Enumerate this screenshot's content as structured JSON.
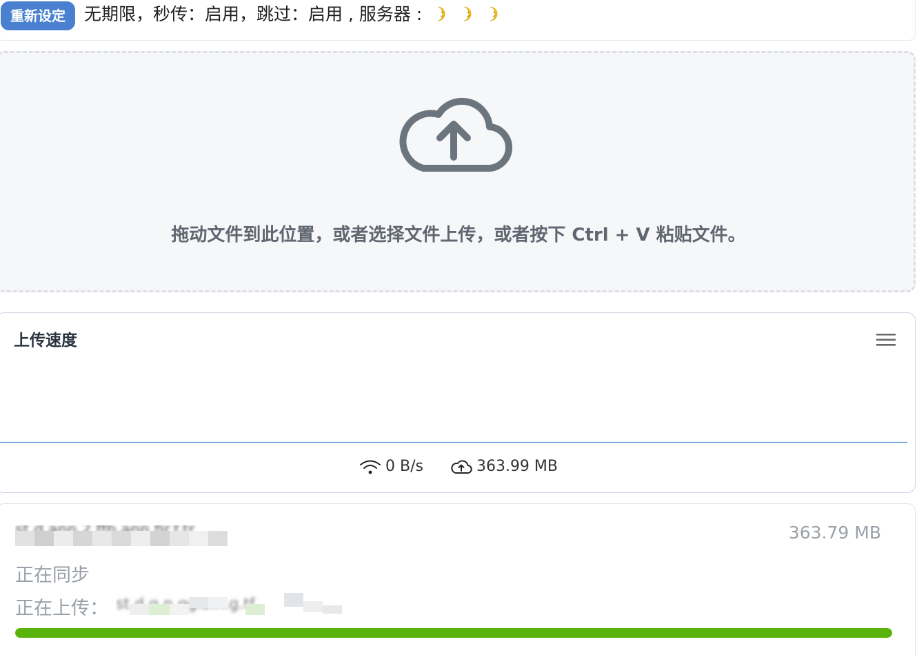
{
  "status_bar": {
    "reset_label": "重新设定",
    "status_text": "无期限，秒传：启用，跳过：启用 , 服务器 :",
    "server_icons": [
      "moon-icon",
      "moon-icon",
      "moon-icon"
    ]
  },
  "dropzone": {
    "icon": "cloud-upload-icon",
    "hint": "拖动文件到此位置，或者选择文件上传，或者按下 Ctrl + V 粘贴文件。"
  },
  "speed_panel": {
    "title": "上传速度",
    "menu_icon": "hamburger-menu-icon",
    "speed_icon": "wifi-icon",
    "speed_value": "0 B/s",
    "total_icon": "cloud-upload-icon",
    "total_value": "363.99 MB"
  },
  "file_item": {
    "name": "st.d.ann.2.ffb.ann.fir.f.tr",
    "size": "363.79 MB",
    "sync_status": "正在同步",
    "uploading_label": "正在上传：",
    "uploading_target": "st.d.g.n.gg.s.n.g.tf",
    "progress": 1.0
  },
  "colors": {
    "accent": "#4a80d0",
    "progress": "#59b30b",
    "muted": "#9aa0a8"
  }
}
